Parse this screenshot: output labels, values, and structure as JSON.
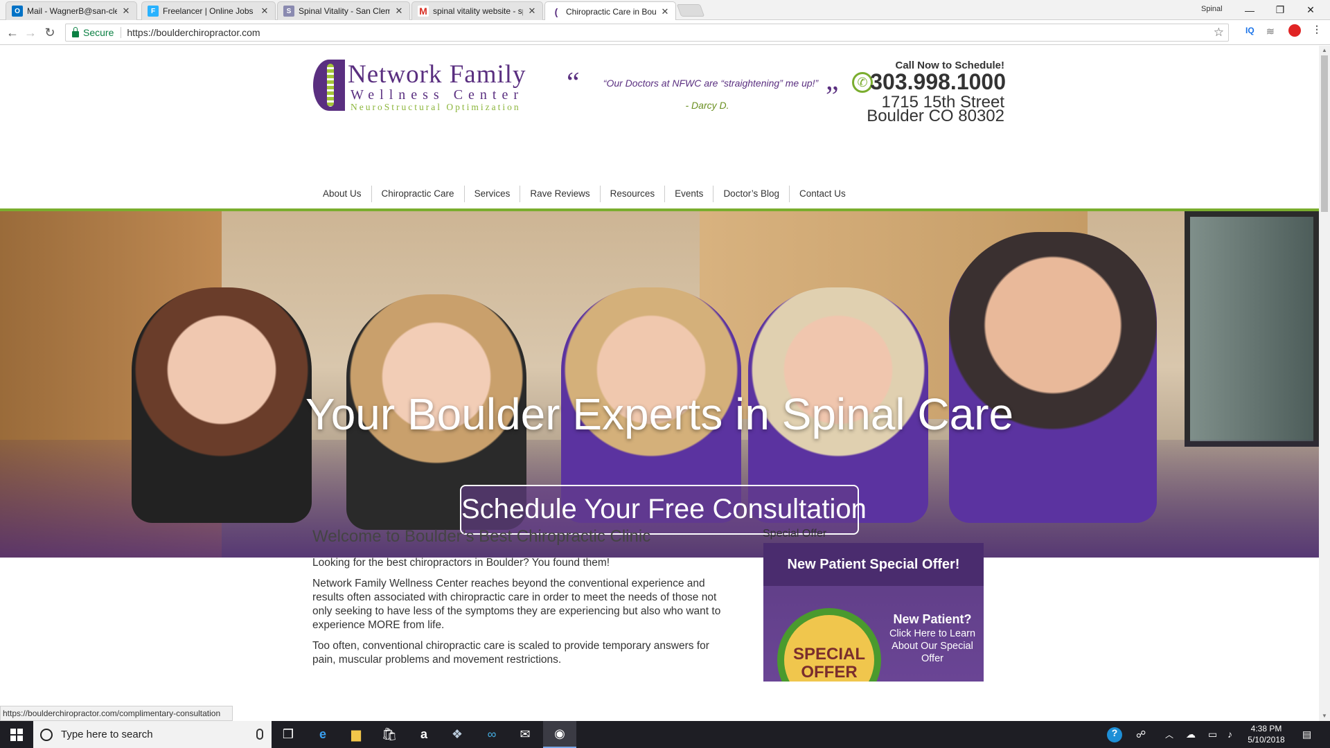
{
  "browser": {
    "tabs": [
      {
        "label": "Mail - WagnerB@san-cle",
        "icon": "outlook-icon",
        "color": "#0072c6",
        "glyph": "O"
      },
      {
        "label": "Freelancer | Online Jobs |",
        "icon": "freelancer-icon",
        "color": "#29b2fe",
        "glyph": "F"
      },
      {
        "label": "Spinal Vitality - San Clem",
        "icon": "spine-icon",
        "color": "#8a8ab0",
        "glyph": "S"
      },
      {
        "label": "spinal vitality website - sp",
        "icon": "gmail-icon",
        "color": "#d93025",
        "glyph": "M"
      },
      {
        "label": "Chiropractic Care in Boul",
        "icon": "nfwc-icon",
        "color": "#5a2f80",
        "glyph": "("
      }
    ],
    "profile": "Spinal",
    "secure_label": "Secure",
    "url": "https://boulderchiropractor.com",
    "status_url": "https://boulderchiropractor.com/complimentary-consultation"
  },
  "header": {
    "logo": {
      "line1": "Network Family",
      "line2": "Wellness Center",
      "line3": "NeuroStructural Optimization"
    },
    "quote": {
      "open_mark": "“",
      "close_mark": "”",
      "text": "“Our Doctors at NFWC are “straightening” me up!”",
      "author": "- Darcy D."
    },
    "contact": {
      "call_label": "Call Now to Schedule!",
      "phone": "303.998.1000",
      "address_line1": "1715 15th Street",
      "address_line2": "Boulder CO 80302"
    }
  },
  "nav": {
    "items": [
      "About Us",
      "Chiropractic Care",
      "Services",
      "Rave Reviews",
      "Resources",
      "Events",
      "Doctor’s Blog",
      "Contact Us"
    ]
  },
  "hero": {
    "title": "Your Boulder Experts in Spinal Care",
    "cta": "Schedule Your Free Consultation"
  },
  "content": {
    "heading": "Welcome to Boulder’s Best Chiropractic Clinic",
    "paragraph1": "Looking for the best chiropractors in Boulder? You found them!",
    "paragraph2": "Network Family Wellness Center reaches beyond the conventional experience and results often associated with chiropractic care in order to meet the needs of those not only seeking to have less of the symptoms they are experiencing but also who want to experience MORE from life.",
    "paragraph3": "Too often, conventional chiropractic care is scaled to provide temporary answers for pain, muscular problems and movement restrictions."
  },
  "special_offer": {
    "heading": "Special Offer",
    "title": "New Patient Special Offer!",
    "badge": "SPECIAL OFFER",
    "new_patient": "New Patient?",
    "sub": "Click Here to Learn About Our Special Offer"
  },
  "taskbar": {
    "search_placeholder": "Type here to search",
    "time": "4:38 PM",
    "date": "5/10/2018"
  },
  "colors": {
    "brand_purple": "#5a2f80",
    "brand_green": "#7aad2e"
  }
}
